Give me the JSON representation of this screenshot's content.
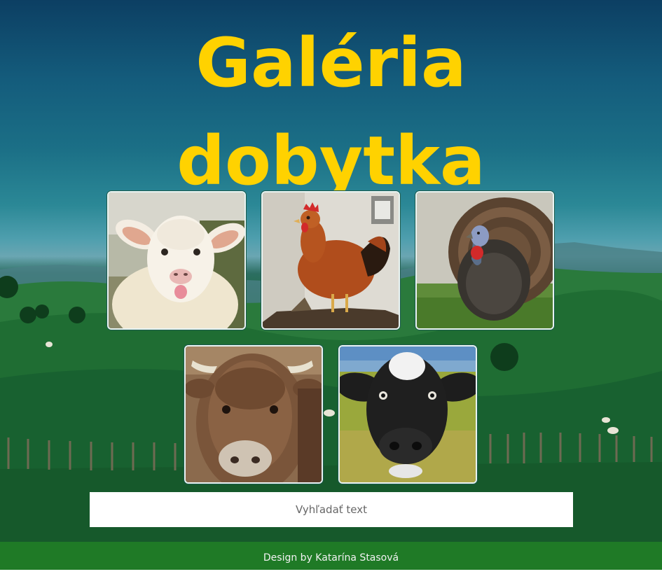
{
  "header": {
    "title_line1": "Galéria",
    "title_line2": "dobytka"
  },
  "gallery": {
    "items": [
      {
        "name": "sheep-photo"
      },
      {
        "name": "chicken-photo"
      },
      {
        "name": "turkey-photo"
      },
      {
        "name": "bull-photo"
      },
      {
        "name": "cow-photo"
      }
    ]
  },
  "search": {
    "placeholder": "Vyhľadať text",
    "value": ""
  },
  "footer": {
    "credit": "Design by Katarína Stasová"
  },
  "colors": {
    "title": "#ffd200",
    "footer_bg": "#1f7a26",
    "search_bg": "#ffffff"
  }
}
